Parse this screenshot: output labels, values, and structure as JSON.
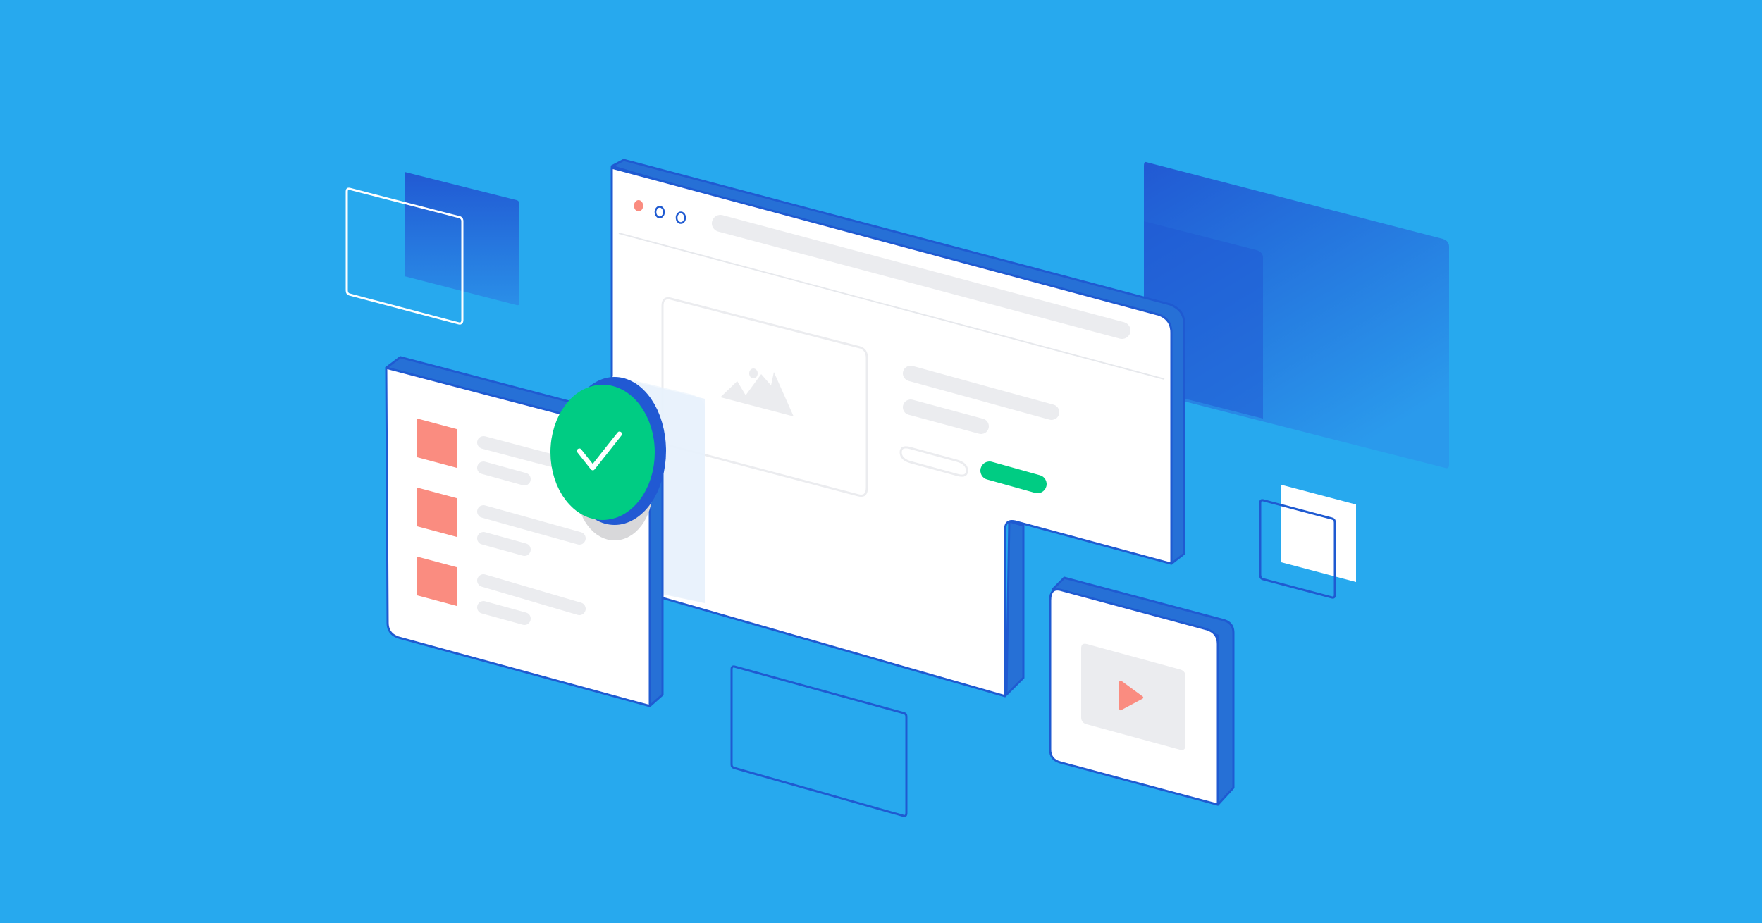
{
  "scene": {
    "description": "",
    "background": "#27a9ee"
  },
  "palette": {
    "background": "#27a9ee",
    "outline_blue": "#1f5ad1",
    "deep_blue": "#2159d3",
    "mid_blue": "#2670d6",
    "card_white": "#ffffff",
    "placeholder_gray": "#ebecef",
    "success_green": "#00cc83",
    "accent_salmon": "#fa8c80",
    "shadow_gray": "#d8d8da",
    "glass_blue": "#e8f1fc"
  },
  "browser_window": {
    "traffic_lights": [
      "close-dot",
      "minimize-dot",
      "maximize-dot"
    ],
    "address_bar": "placeholder",
    "image_icon": "image-placeholder-icon",
    "primary_button_color": "#00cc83",
    "secondary_button": "outline"
  },
  "list_card": {
    "items": [
      {
        "thumb": "salmon-square"
      },
      {
        "thumb": "salmon-square"
      },
      {
        "thumb": "salmon-square"
      }
    ]
  },
  "check_badge": {
    "icon": "checkmark-icon",
    "color": "#00cc83"
  },
  "video_card": {
    "icon": "play-icon",
    "icon_color": "#fa8c80"
  }
}
